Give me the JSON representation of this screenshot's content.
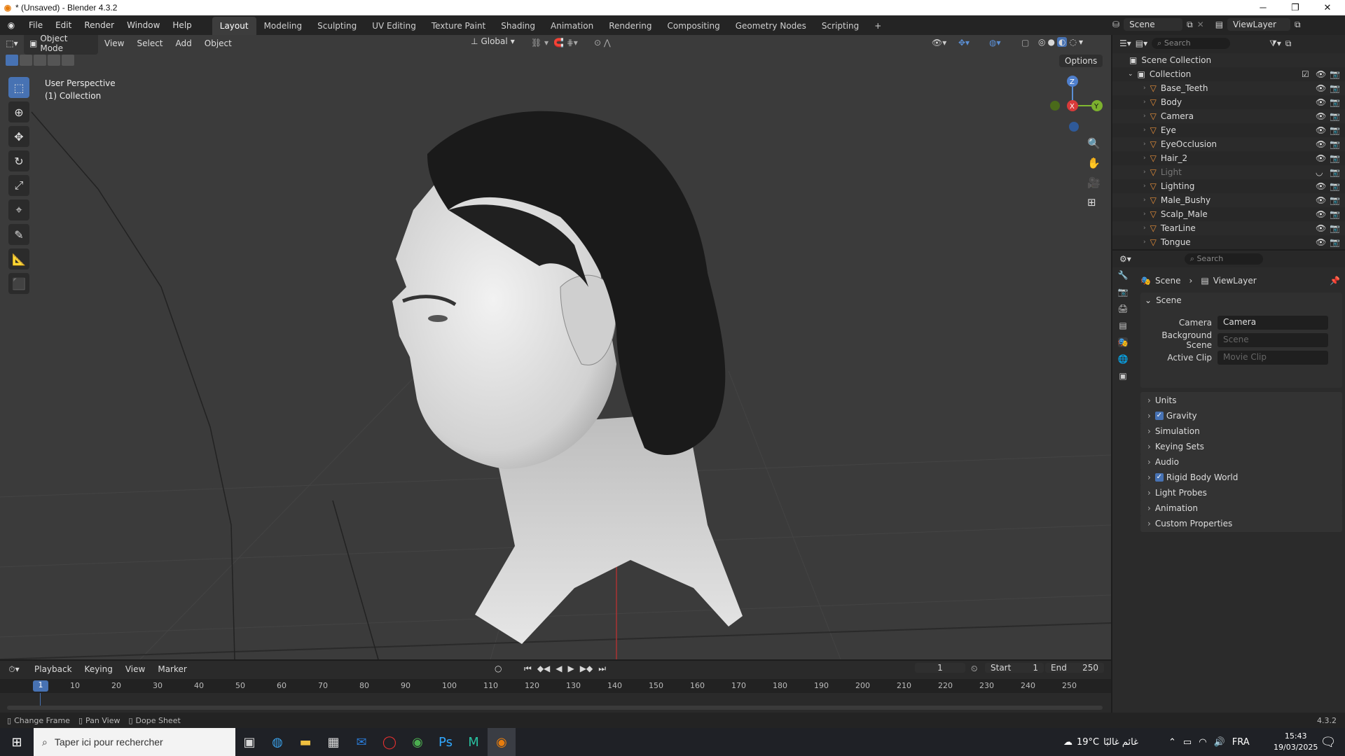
{
  "window": {
    "title": "* (Unsaved) - Blender 4.3.2"
  },
  "menu": [
    "File",
    "Edit",
    "Render",
    "Window",
    "Help"
  ],
  "workspaces": [
    "Layout",
    "Modeling",
    "Sculpting",
    "UV Editing",
    "Texture Paint",
    "Shading",
    "Animation",
    "Rendering",
    "Compositing",
    "Geometry Nodes",
    "Scripting"
  ],
  "scene_selector": {
    "scene": "Scene",
    "view_layer": "ViewLayer"
  },
  "viewport_header": {
    "mode": "Object Mode",
    "items": [
      "View",
      "Select",
      "Add",
      "Object"
    ],
    "transform": "Global",
    "options": "Options"
  },
  "viewport_overlay": {
    "perspective": "User Perspective",
    "collection": "(1) Collection"
  },
  "gizmo": {
    "z": "Z",
    "y": "Y",
    "x": "X"
  },
  "outliner": {
    "search_placeholder": "Search",
    "root": "Scene Collection",
    "collection": "Collection",
    "items": [
      {
        "name": "Base_Teeth"
      },
      {
        "name": "Body"
      },
      {
        "name": "Camera"
      },
      {
        "name": "Eye"
      },
      {
        "name": "EyeOcclusion"
      },
      {
        "name": "Hair_2"
      },
      {
        "name": "Light"
      },
      {
        "name": "Lighting"
      },
      {
        "name": "Male_Bushy"
      },
      {
        "name": "Scalp_Male"
      },
      {
        "name": "TearLine"
      },
      {
        "name": "Tongue"
      }
    ]
  },
  "properties": {
    "search_placeholder": "Search",
    "breadcrumb": [
      "Scene",
      "ViewLayer"
    ],
    "section": "Scene",
    "fields": [
      {
        "label": "Camera",
        "value": "Camera"
      },
      {
        "label": "Background Scene",
        "value": "Scene"
      },
      {
        "label": "Active Clip",
        "value": "Movie Clip"
      }
    ],
    "panels": [
      {
        "label": "Units",
        "check": false
      },
      {
        "label": "Gravity",
        "check": true
      },
      {
        "label": "Simulation",
        "check": false
      },
      {
        "label": "Keying Sets",
        "check": false
      },
      {
        "label": "Audio",
        "check": false
      },
      {
        "label": "Rigid Body World",
        "check": true
      },
      {
        "label": "Light Probes",
        "check": false
      },
      {
        "label": "Animation",
        "check": false
      },
      {
        "label": "Custom Properties",
        "check": false
      }
    ]
  },
  "timeline": {
    "menus": [
      "Playback",
      "Keying",
      "View",
      "Marker"
    ],
    "current_frame": "1",
    "start_label": "Start",
    "start": "1",
    "end_label": "End",
    "end": "250",
    "ticks": [
      "10",
      "20",
      "30",
      "40",
      "50",
      "60",
      "70",
      "80",
      "90",
      "100",
      "110",
      "120",
      "130",
      "140",
      "150",
      "160",
      "170",
      "180",
      "190",
      "200",
      "210",
      "220",
      "230",
      "240",
      "250"
    ],
    "cursor": "1"
  },
  "statusbar": {
    "items": [
      "Change Frame",
      "Pan View",
      "Dope Sheet"
    ],
    "version": "4.3.2"
  },
  "taskbar": {
    "search_placeholder": "Taper ici pour rechercher",
    "weather": "19°C",
    "weather_text": "غائم غالبًا",
    "lang": "FRA",
    "time": "15:43",
    "date": "19/03/2025"
  }
}
